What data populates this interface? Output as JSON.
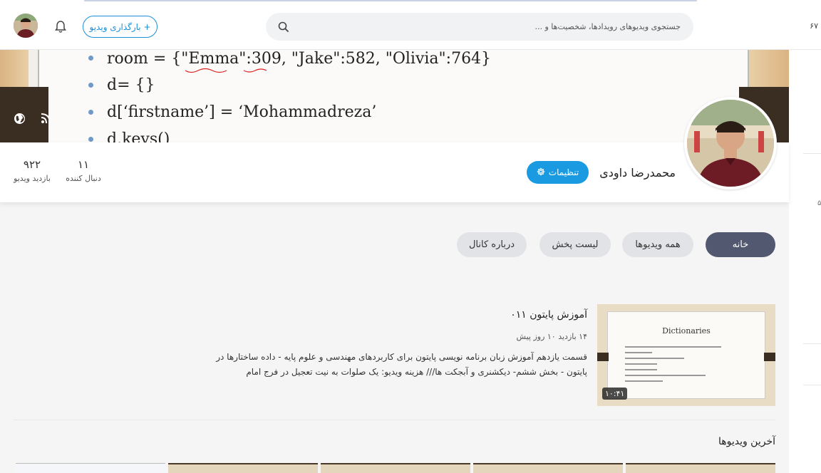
{
  "header": {
    "upload_label": "+ بارگذاری ویدیو",
    "search_placeholder": "جستجوی ویدیوهای رویدادها، شخصیت‌ها و ...",
    "corner_text": "۶۷"
  },
  "banner": {
    "code_lines": [
      "room = {\"Emma\":309, \"Jake\":582, \"Olivia\":764}",
      "d= {}",
      "d[‘firstname’] = ‘Mohammadreza’",
      "d.keys()"
    ]
  },
  "channel": {
    "name": "محمدرضا داودی",
    "settings_label": "تنظیمات",
    "followers_value": "۱۱",
    "followers_label": "دنبال کننده",
    "views_value": "۹۲۲",
    "views_label": "بازدید ویدیو"
  },
  "tabs": [
    {
      "label": "خانه",
      "active": true
    },
    {
      "label": "همه ویدیوها",
      "active": false
    },
    {
      "label": "لیست پخش",
      "active": false
    },
    {
      "label": "درباره کانال",
      "active": false
    }
  ],
  "featured_video": {
    "title": "آموزش پایتون ۰۱۱",
    "meta": "۱۴ بازدید  ۱۰ روز پیش",
    "description": "قسمت یازدهم آموزش زبان برنامه نویسی پایتون برای کاربردهای مهندسی و علوم پایه - داده ساختارها در پایتون - بخش ششم- دیکشنری و آبجکت ها/// هزینه ویدیو: یک صلوات به نیت تعجیل در فرج امام",
    "duration": "۱۰:۴۱",
    "thumb_title": "Dictionaries"
  },
  "latest_section": {
    "title": "آخرین ویدیوها"
  }
}
